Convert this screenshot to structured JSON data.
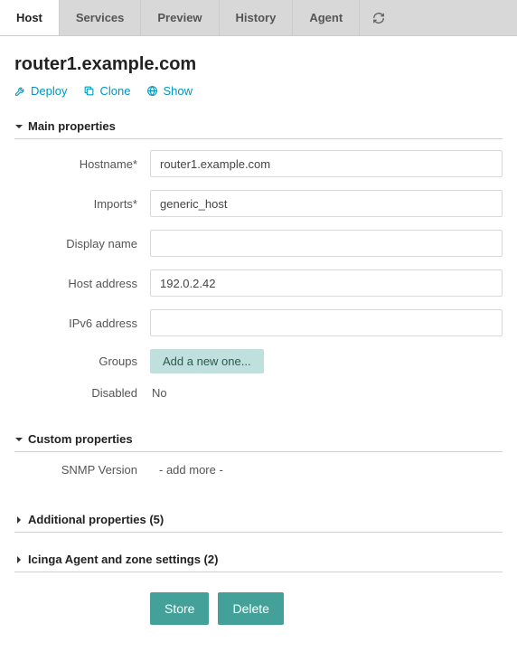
{
  "tabs": {
    "host": "Host",
    "services": "Services",
    "preview": "Preview",
    "history": "History",
    "agent": "Agent"
  },
  "title": "router1.example.com",
  "actions": {
    "deploy": "Deploy",
    "clone": "Clone",
    "show": "Show"
  },
  "sections": {
    "main": {
      "title": "Main properties"
    },
    "custom": {
      "title": "Custom properties"
    },
    "additional": {
      "title": "Additional properties (5)"
    },
    "agent_zone": {
      "title": "Icinga Agent and zone settings (2)"
    }
  },
  "fields": {
    "hostname": {
      "label": "Hostname*",
      "value": "router1.example.com"
    },
    "imports": {
      "label": "Imports*",
      "value": "generic_host"
    },
    "display_name": {
      "label": "Display name",
      "value": ""
    },
    "host_address": {
      "label": "Host address",
      "value": "192.0.2.42"
    },
    "ipv6_address": {
      "label": "IPv6 address",
      "value": ""
    },
    "groups": {
      "label": "Groups",
      "placeholder": "Add a new one..."
    },
    "disabled": {
      "label": "Disabled",
      "value": "No"
    },
    "snmp_version": {
      "label": "SNMP Version",
      "value": "- add more -"
    }
  },
  "buttons": {
    "store": "Store",
    "delete": "Delete"
  }
}
